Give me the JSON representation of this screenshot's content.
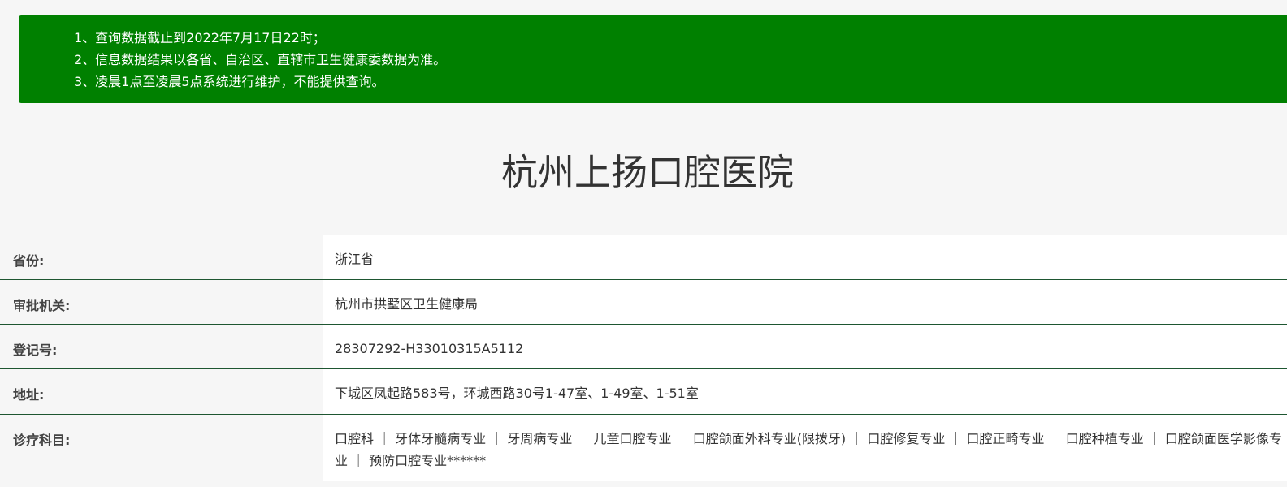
{
  "notice": {
    "lines": [
      "1、查询数据截止到2022年7月17日22时；",
      "2、信息数据结果以各省、自治区、直辖市卫生健康委数据为准。",
      "3、凌晨1点至凌晨5点系统进行维护，不能提供查询。"
    ]
  },
  "hospital": {
    "name": "杭州上扬口腔医院"
  },
  "details": {
    "province_label": "省份:",
    "province_value": "浙江省",
    "authority_label": "审批机关:",
    "authority_value": "杭州市拱墅区卫生健康局",
    "registration_label": "登记号:",
    "registration_value": "28307292-H33010315A5112",
    "address_label": "地址:",
    "address_value": "下城区凤起路583号，环城西路30号1-47室、1-49室、1-51室",
    "departments_label": "诊疗科目:",
    "departments_value": "口腔科 ｜ 牙体牙髓病专业 ｜ 牙周病专业 ｜ 儿童口腔专业 ｜ 口腔颌面外科专业(限拨牙) ｜ 口腔修复专业 ｜ 口腔正畸专业 ｜ 口腔种植专业 ｜ 口腔颌面医学影像专业 ｜ 预防口腔专业******"
  }
}
